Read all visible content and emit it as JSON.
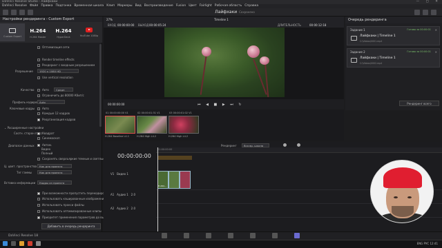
{
  "window": {
    "title": "DaVinci Resolve Studio - Лайфхаки",
    "controls": "— ▢ ✕"
  },
  "menu": [
    "DaVinci Resolve",
    "Файл",
    "Правка",
    "Подгонка",
    "Временная шкала",
    "Клип",
    "Маркеры",
    "Вид",
    "Воспроизведение",
    "Fusion",
    "Цвет",
    "Fairlight",
    "Рабочая область",
    "Справка"
  ],
  "project": {
    "name": "Лайфхаки",
    "status": "Сохранено"
  },
  "render_settings": {
    "header": "Настройки рендеринга - Custom Export",
    "presets": [
      {
        "big": "",
        "label": "Custom Export"
      },
      {
        "big": "H.264",
        "label": "H.264 Master"
      },
      {
        "big": "H.264",
        "label": "HyperDeck"
      },
      {
        "big": "",
        "label": "YouTube 1080p"
      }
    ],
    "rows": [
      {
        "label": "Оптимизация сети",
        "checked": false
      },
      {
        "label": "Render timeline effects",
        "checked": false
      },
      {
        "label": "Рендеринг с входным разрешением",
        "checked": false
      }
    ],
    "resolution_label": "Разрешение",
    "resolution_value": "1920 x 1080 HD",
    "use_vertical": "Use vertical resolution",
    "quality_label": "Качество",
    "quality_auto": "Авто",
    "quality_mid": "Средн",
    "limit_label": "Ограничить до",
    "limit_value": "80000",
    "limit_unit": "Кбит/с",
    "profile_label": "Профиль кодирова",
    "profile_value": "Auto",
    "keyframes_label": "Ключевые кадры",
    "keyframes_auto": "Авто",
    "keyframes_each": "Каждые",
    "keyframes_n": "12",
    "keyframes_unit": "кадров",
    "reorder": "Реорганизация кадров",
    "advanced": "Расширенные настройки",
    "aspect_label": "Соотн. сторон пикс",
    "aspect_square": "Квадрат",
    "aspect_cinema": "Синемаскоп",
    "range_label": "Диапазон данных",
    "range_auto": "Автом.",
    "range_video": "Видео",
    "range_full": "Полный",
    "save_dark": "Сохранять сверхъяркие темные и светлые тона",
    "colorspace_label": "Ц. цвет. пространства",
    "colorspace_value": "Как для проекта",
    "gamma_label": "Тег гаммы",
    "gamma_value": "Как для проекта",
    "insert_label": "Вставка информации",
    "insert_value": "Кадры из проекта",
    "bottom_rows": [
      {
        "label": "При возможности пропустить перекодировку",
        "checked": true
      },
      {
        "label": "Использовать кэшированные изображения",
        "checked": false
      },
      {
        "label": "Использовать прокси файлы",
        "checked": false
      },
      {
        "label": "Использовать оптимизированные клипы",
        "checked": false
      },
      {
        "label": "Приоритет применения параметров до вывод",
        "checked": true
      }
    ],
    "add_to_queue": "Добавить в очередь рендеринга"
  },
  "viewer": {
    "zoom": "27%",
    "in_label": "ВХОД",
    "in_tc": "00:00:00:00",
    "out_label": "ВЫХОД",
    "out_tc": "00:00:05:24",
    "timeline_name": "Timeline 1",
    "duration_label": "ДЛИТЕЛЬНОСТЬ",
    "duration_tc": "00:00:12:18",
    "current_tc": "00:00:00:00",
    "transport": "⏮ ◀ ■ ▶ ⏭ ↻"
  },
  "clips": [
    {
      "idx": "01",
      "tc": "00:00:00:00",
      "track": "V1",
      "name": "H.264 Baseline L4.1"
    },
    {
      "idx": "02",
      "tc": "00:00:01:31",
      "track": "V1",
      "name": "H.264 High L4.2"
    },
    {
      "idx": "03",
      "tc": "00:00:01:02",
      "track": "V1",
      "name": "H.264 High L4.2"
    }
  ],
  "timeline": {
    "tc": "00:00:00:00",
    "render_label": "Рендеринг",
    "render_value": "Вся вр. шкала",
    "v1": "V1",
    "v1_name": "Видео 1",
    "a1": "A1",
    "a1_name": "Аудио 1",
    "a2": "A2",
    "a2_name": "Аудио 2",
    "a_level": "2.0",
    "clip_label": "H.264...",
    "ruler_start": "01:00:00:00"
  },
  "render_queue": {
    "header": "Очередь рендеринга",
    "jobs": [
      {
        "title": "Задание 1",
        "progress": "Готово за 00:00:01",
        "name": "Лайфхаки | Timeline 1",
        "sub": "C:\\Videos\\0001.mp4"
      },
      {
        "title": "Задание 2",
        "progress": "Готово за 00:00:01",
        "name": "Лайфхаки | Timeline 1",
        "sub": "C:\\Videos\\0002.mp4"
      }
    ],
    "render_all": "Рендеринг всего"
  },
  "bottom": {
    "app": "DaVinci Resolve 18",
    "tray": "ENG  РУС  12:41"
  }
}
